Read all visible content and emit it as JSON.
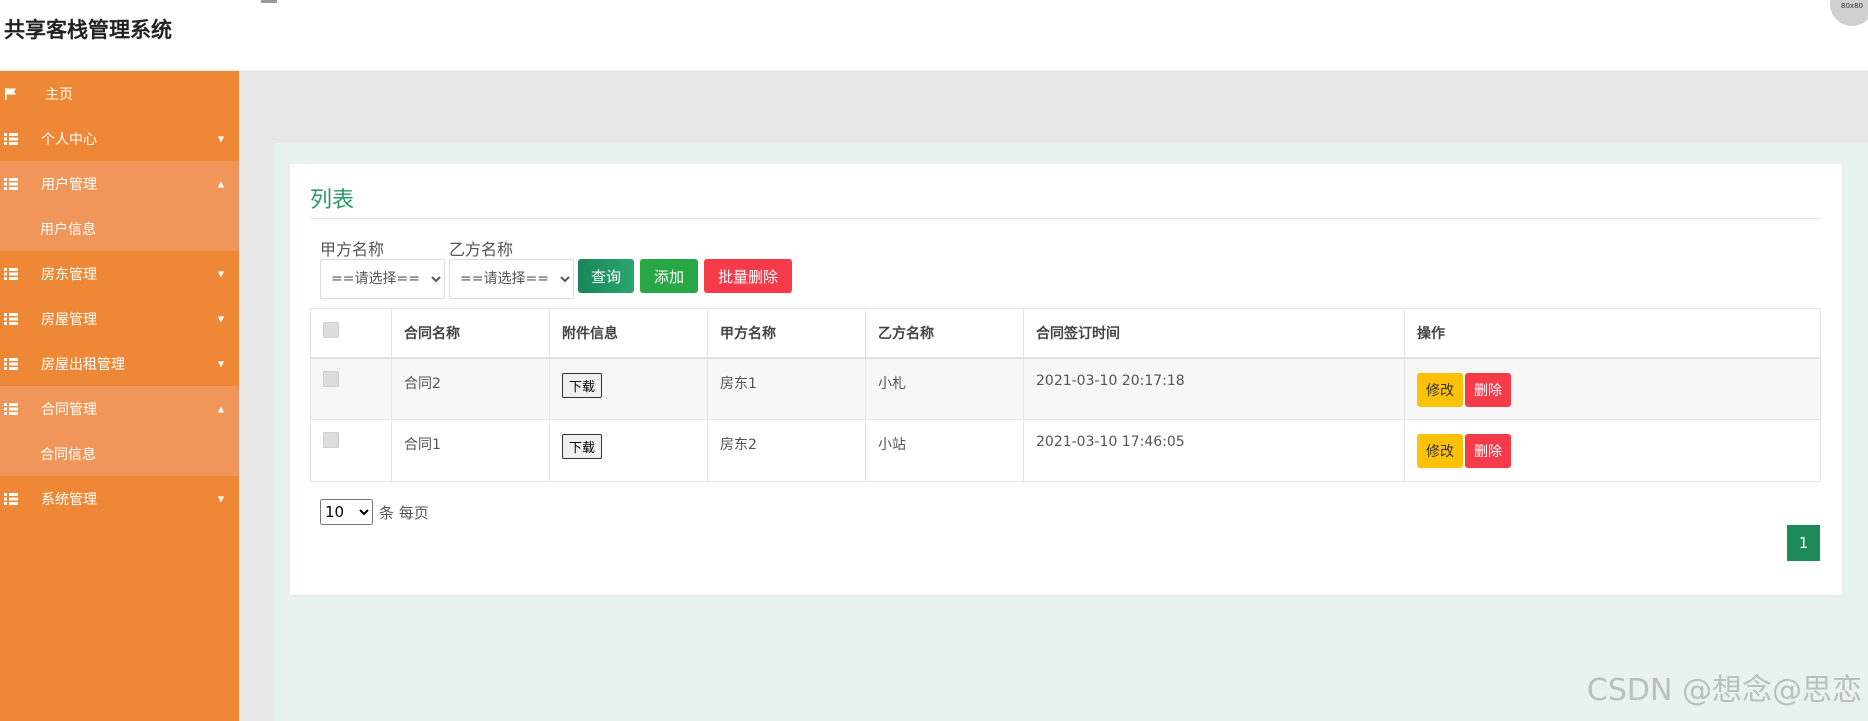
{
  "header": {
    "app_title": "共享客栈管理系统",
    "avatar_text": "80x80"
  },
  "sidebar": {
    "items": [
      {
        "label": "主页",
        "icon": "flag-icon"
      },
      {
        "label": "个人中心",
        "icon": "grid-icon"
      },
      {
        "label": "用户管理",
        "icon": "grid-icon",
        "sub": [
          "用户信息"
        ]
      },
      {
        "label": "房东管理",
        "icon": "grid-icon"
      },
      {
        "label": "房屋管理",
        "icon": "grid-icon"
      },
      {
        "label": "房屋出租管理",
        "icon": "grid-icon"
      },
      {
        "label": "合同管理",
        "icon": "grid-icon",
        "sub": [
          "合同信息"
        ]
      },
      {
        "label": "系统管理",
        "icon": "grid-icon"
      }
    ]
  },
  "panel": {
    "title": "列表",
    "filters": {
      "party_a_label": "甲方名称",
      "party_b_label": "乙方名称",
      "select_placeholder": "==请选择=="
    },
    "buttons": {
      "search": "查询",
      "add": "添加",
      "batch_delete": "批量删除"
    },
    "table": {
      "headers": [
        "合同名称",
        "附件信息",
        "甲方名称",
        "乙方名称",
        "合同签订时间",
        "操作"
      ],
      "rows": [
        {
          "contract": "合同2",
          "attachment": "下载",
          "party_a": "房东1",
          "party_b": "小札",
          "signed_at": "2021-03-10 20:17:18"
        },
        {
          "contract": "合同1",
          "attachment": "下载",
          "party_a": "房东2",
          "party_b": "小站",
          "signed_at": "2021-03-10 17:46:05"
        }
      ],
      "action_edit": "修改",
      "action_delete": "删除"
    },
    "pagination": {
      "page_size": "10",
      "per_page_text": "条 每页",
      "current_page": "1"
    }
  },
  "watermark": "CSDN @想念@思恋",
  "colors": {
    "sidebar": "#ee8837",
    "accent_green": "#2a9a64",
    "danger": "#f53a4a",
    "warning": "#ffc107"
  }
}
